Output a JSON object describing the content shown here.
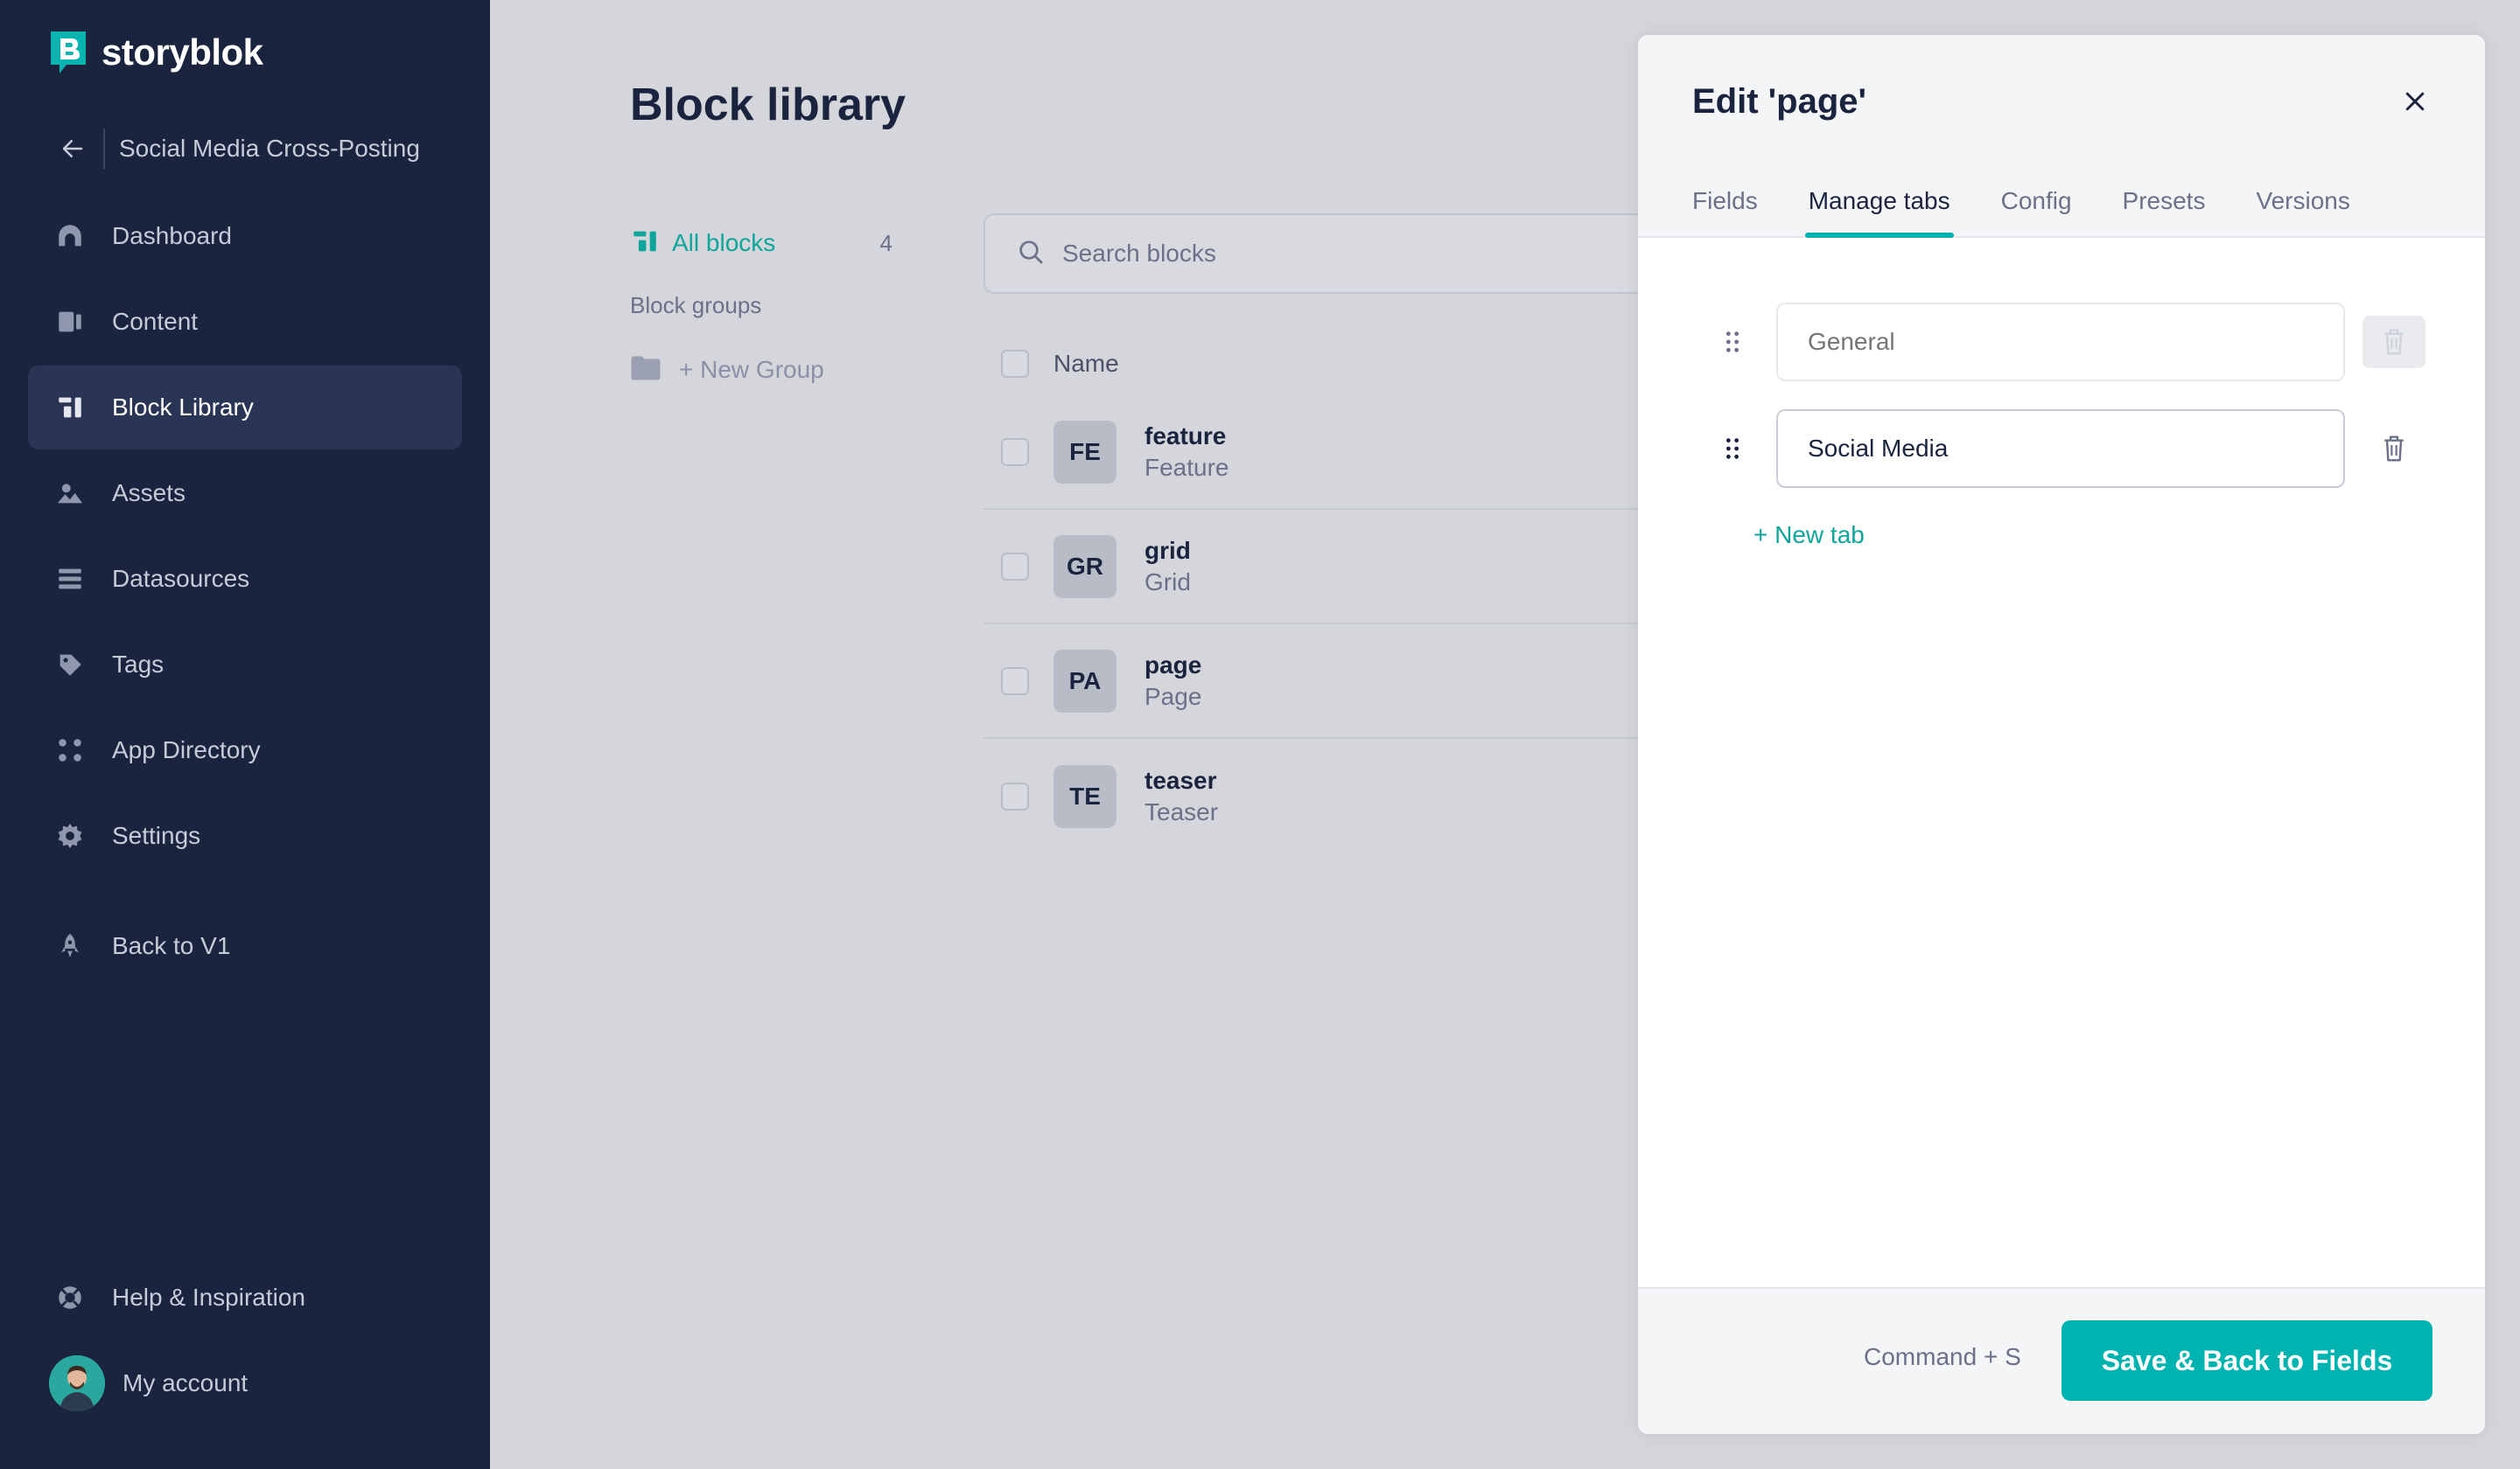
{
  "app": {
    "brand": "storyblok",
    "space_name": "Social Media Cross-Posting"
  },
  "sidebar": {
    "items": [
      {
        "label": "Dashboard",
        "icon": "dashboard-icon"
      },
      {
        "label": "Content",
        "icon": "content-icon"
      },
      {
        "label": "Block Library",
        "icon": "block-library-icon",
        "active": true
      },
      {
        "label": "Assets",
        "icon": "assets-icon"
      },
      {
        "label": "Datasources",
        "icon": "datasources-icon"
      },
      {
        "label": "Tags",
        "icon": "tags-icon"
      },
      {
        "label": "App Directory",
        "icon": "app-directory-icon"
      },
      {
        "label": "Settings",
        "icon": "settings-icon"
      }
    ],
    "back_to_v1": "Back to V1",
    "help": "Help & Inspiration",
    "account": "My account"
  },
  "main": {
    "title": "Block library",
    "all_blocks_label": "All blocks",
    "all_blocks_count": "4",
    "groups_heading": "Block groups",
    "new_group": "+ New Group",
    "search_placeholder": "Search blocks",
    "table_header_name": "Name",
    "rows": [
      {
        "initials": "FE",
        "name": "feature",
        "label": "Feature"
      },
      {
        "initials": "GR",
        "name": "grid",
        "label": "Grid"
      },
      {
        "initials": "PA",
        "name": "page",
        "label": "Page"
      },
      {
        "initials": "TE",
        "name": "teaser",
        "label": "Teaser"
      }
    ]
  },
  "modal": {
    "title": "Edit 'page'",
    "tabs": [
      {
        "label": "Fields"
      },
      {
        "label": "Manage tabs",
        "active": true
      },
      {
        "label": "Config"
      },
      {
        "label": "Presets"
      },
      {
        "label": "Versions"
      }
    ],
    "tab_entries": [
      {
        "placeholder": "General",
        "value": "",
        "disabled": true
      },
      {
        "placeholder": "",
        "value": "Social Media",
        "disabled": false
      }
    ],
    "new_tab": "+ New tab",
    "shortcut": "Command + S",
    "save_button": "Save & Back to Fields"
  },
  "colors": {
    "sidebar_bg": "#1b243f",
    "accent": "#00b3b0",
    "accent_text": "#0fa59b"
  }
}
